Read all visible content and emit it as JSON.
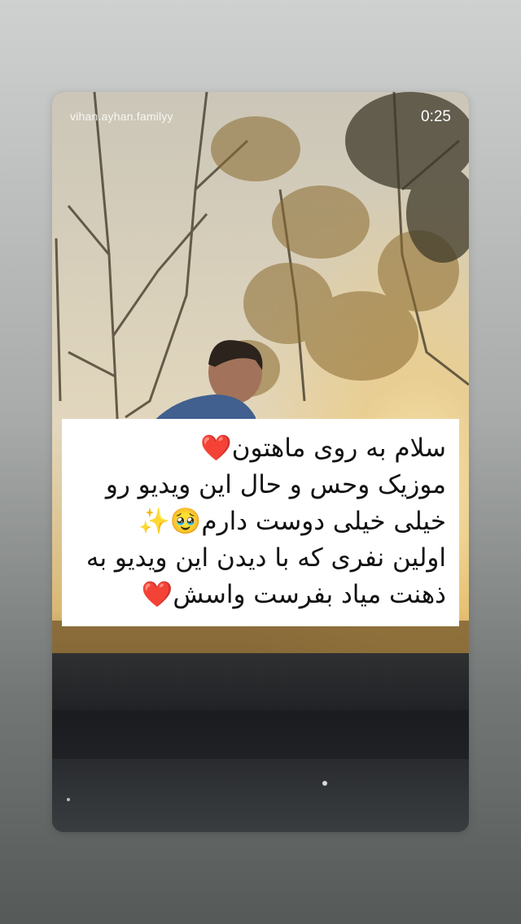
{
  "story": {
    "username": "vihan.ayhan.familyy",
    "timestamp": "0:25"
  },
  "caption": {
    "lines": [
      "سلام به روی ماهتون❤️",
      "موزیک وحس و حال این ویدیو رو",
      "خیلی خیلی دوست دارم🥹✨",
      "اولین نفری که با دیدن این ویدیو به",
      "ذهنت میاد بفرست واسش❤️"
    ]
  },
  "colors": {
    "caption_background": "#ffffff",
    "caption_text": "#111111",
    "overlay_text": "#ffffff"
  }
}
